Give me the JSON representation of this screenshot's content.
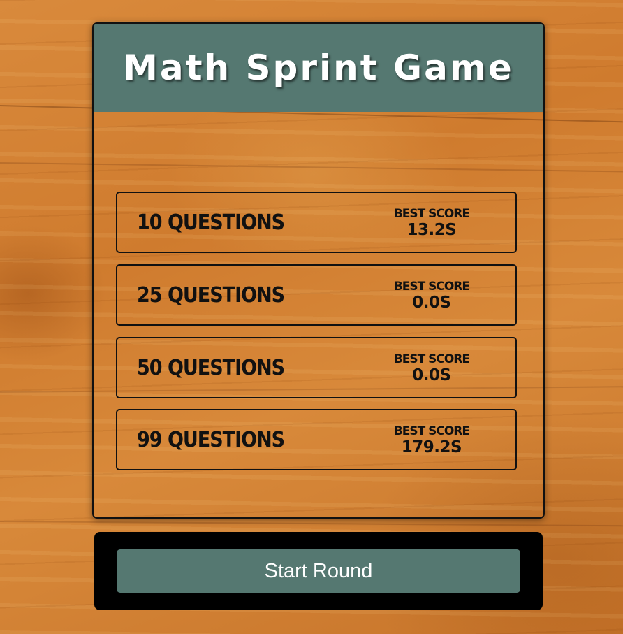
{
  "header": {
    "title": "Math Sprint Game"
  },
  "question_options": [
    {
      "label": "10 Questions",
      "best_score_title": "Best Score",
      "best_score_value": "13.2s"
    },
    {
      "label": "25 Questions",
      "best_score_title": "Best Score",
      "best_score_value": "0.0s"
    },
    {
      "label": "50 Questions",
      "best_score_title": "Best Score",
      "best_score_value": "0.0s"
    },
    {
      "label": "99 Questions",
      "best_score_title": "Best Score",
      "best_score_value": "179.2s"
    }
  ],
  "footer": {
    "start_label": "Start Round"
  },
  "colors": {
    "header_bg": "#557871",
    "button_bg": "#557871",
    "footer_bg": "#000000",
    "background_wood": "#d0802f"
  }
}
